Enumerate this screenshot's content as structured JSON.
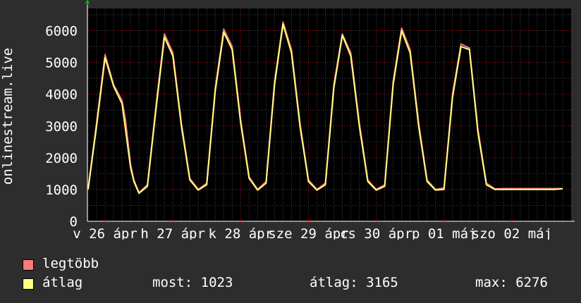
{
  "colors": {
    "background": "#2d2d2d",
    "plot_background": "#000000",
    "grid_major": "#8b1a1a",
    "grid_minor": "#4a4a4a",
    "max_series": "#ff7a7a",
    "avg_series": "#ffff80",
    "axis_arrow": "#00c000"
  },
  "legend": {
    "max_label": "legtöbb",
    "avg_label": "átlag",
    "now": "most: 1023",
    "avg": "átlag: 3165",
    "max": "max: 6276"
  },
  "chart_data": {
    "type": "line",
    "ylabel": "onlinestream.live",
    "ylim": [
      0,
      6700
    ],
    "yticks": [
      0,
      1000,
      2000,
      3000,
      4000,
      5000,
      6000
    ],
    "xlim": [
      0,
      28.5
    ],
    "xticks": [
      {
        "x": 1,
        "label": "v 26 ápr"
      },
      {
        "x": 5,
        "label": "h 27 ápr"
      },
      {
        "x": 9,
        "label": "k 28 ápr"
      },
      {
        "x": 13,
        "label": "sze 29 ápr"
      },
      {
        "x": 17,
        "label": "cs 30 ápr"
      },
      {
        "x": 21,
        "label": "p 01 máj"
      },
      {
        "x": 25,
        "label": "szo 02 máj"
      }
    ],
    "grid": true,
    "series": [
      {
        "name": "legtöbb",
        "color": "#ff7a7a",
        "x": [
          0,
          0.5,
          1,
          1.5,
          2,
          2.2,
          2.5,
          2.7,
          3,
          3.5,
          4,
          4.5,
          5,
          5.5,
          6,
          6.5,
          7,
          7.5,
          8,
          8.5,
          9,
          9.5,
          10,
          10.5,
          11,
          11.5,
          12,
          12.5,
          13,
          13.5,
          14,
          14.5,
          15,
          15.5,
          16,
          16.5,
          17,
          17.5,
          18,
          18.5,
          19,
          19.5,
          20,
          20.5,
          21,
          21.5,
          22,
          22.5,
          23,
          23.5,
          24,
          24.5,
          25,
          25.5,
          26,
          26.5,
          27,
          27.5,
          28
        ],
        "values": [
          1050,
          3100,
          5250,
          4300,
          3800,
          3200,
          1800,
          1300,
          900,
          1150,
          3600,
          5900,
          5300,
          3100,
          1350,
          1000,
          1200,
          4200,
          6050,
          5500,
          3200,
          1400,
          1000,
          1250,
          4400,
          6270,
          5400,
          3100,
          1300,
          1000,
          1200,
          4300,
          5900,
          5300,
          3100,
          1300,
          1000,
          1150,
          4400,
          6080,
          5400,
          3100,
          1300,
          1000,
          1050,
          4000,
          5580,
          5450,
          2900,
          1200,
          1020,
          1030,
          1030,
          1030,
          1030,
          1030,
          1030,
          1030,
          1030
        ]
      },
      {
        "name": "átlag",
        "color": "#ffff80",
        "x": [
          0,
          0.5,
          1,
          1.5,
          2,
          2.2,
          2.5,
          2.7,
          3,
          3.5,
          4,
          4.5,
          5,
          5.5,
          6,
          6.5,
          7,
          7.5,
          8,
          8.5,
          9,
          9.5,
          10,
          10.5,
          11,
          11.5,
          12,
          12.5,
          13,
          13.5,
          14,
          14.5,
          15,
          15.5,
          16,
          16.5,
          17,
          17.5,
          18,
          18.5,
          19,
          19.5,
          20,
          20.5,
          21,
          21.5,
          22,
          22.5,
          23,
          23.5,
          24,
          24.5,
          25,
          25.5,
          26,
          26.5,
          27,
          27.5,
          28
        ],
        "values": [
          1000,
          3000,
          5150,
          4250,
          3700,
          2900,
          1700,
          1250,
          880,
          1100,
          3500,
          5800,
          5200,
          3000,
          1300,
          980,
          1150,
          4100,
          5950,
          5400,
          3100,
          1350,
          980,
          1200,
          4300,
          6200,
          5300,
          3000,
          1250,
          980,
          1150,
          4200,
          5850,
          5200,
          3000,
          1250,
          980,
          1100,
          4300,
          6000,
          5300,
          3000,
          1250,
          980,
          1000,
          3900,
          5500,
          5400,
          2800,
          1150,
          1000,
          1000,
          1000,
          1000,
          1000,
          1000,
          1000,
          1000,
          1023
        ]
      }
    ]
  }
}
